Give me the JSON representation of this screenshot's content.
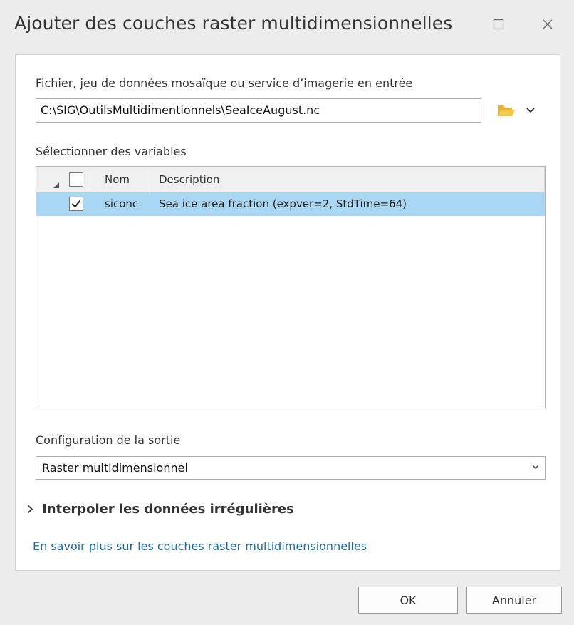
{
  "window": {
    "title": "Ajouter des couches raster multidimensionnelles",
    "maximize_icon": "maximize-icon",
    "close_icon": "close-icon"
  },
  "input_section": {
    "label": "Fichier, jeu de données mosaïque ou service d’imagerie en entrée",
    "value": "C:\\SIG\\OutilsMultidimentionnels\\SeaIceAugust.nc",
    "browse_icon": "folder-open-icon",
    "dropdown_icon": "chevron-down-icon"
  },
  "variables": {
    "label": "Sélectionner des variables",
    "columns": {
      "name": "Nom",
      "description": "Description"
    },
    "header_checked": false,
    "rows": [
      {
        "checked": true,
        "name": "siconc",
        "description": "Sea ice area fraction (expver=2, StdTime=64)"
      }
    ]
  },
  "output": {
    "label": "Configuration de la sortie",
    "selected": "Raster multidimensionnel"
  },
  "interpolate": {
    "label": "Interpoler les données irrégulières",
    "expanded": false
  },
  "help_link": "En savoir plus sur les couches raster multidimensionnelles",
  "buttons": {
    "ok": "OK",
    "cancel": "Annuler"
  },
  "colors": {
    "selected_row": "#a9d6f2",
    "link": "#1a6aa6",
    "folder": "#f2c94c"
  }
}
